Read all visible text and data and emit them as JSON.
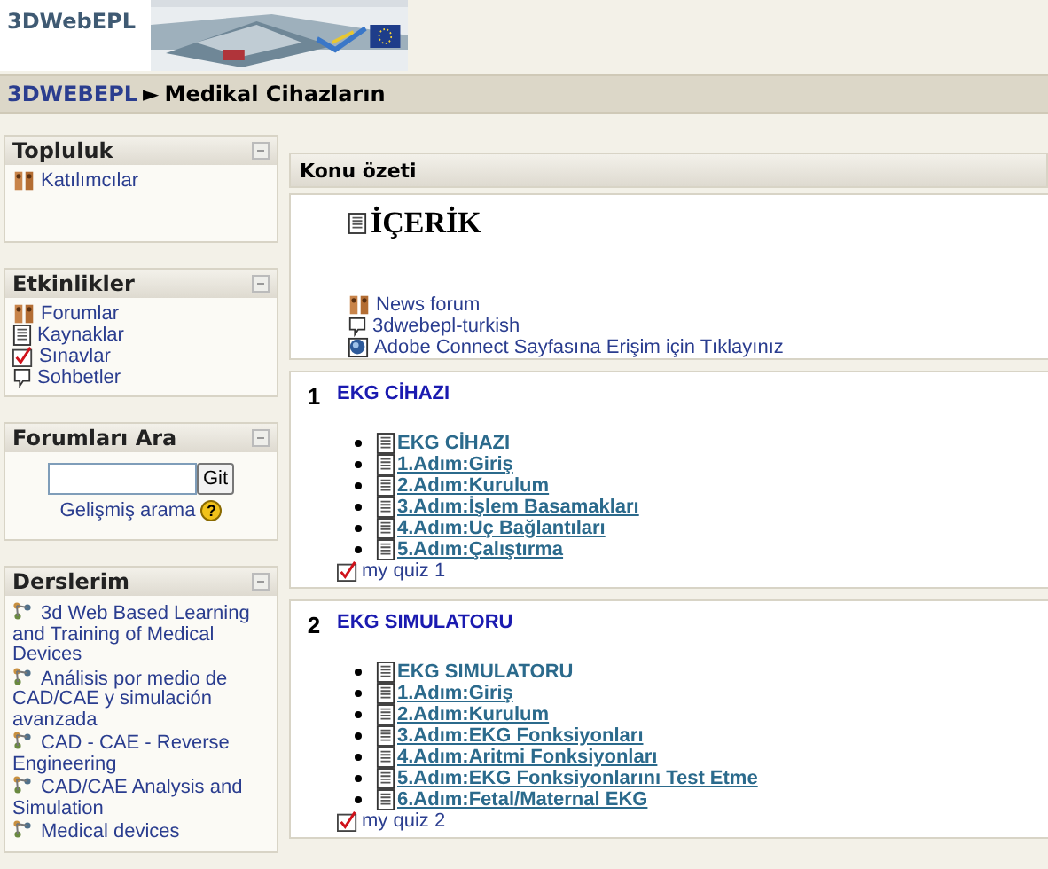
{
  "header": {
    "logo": "3DWebEPL"
  },
  "breadcrumb": {
    "home": "3DWEBEPL",
    "separator": "►",
    "current": "Medikal Cihazların"
  },
  "sidebar": [
    {
      "title": "Topluluk",
      "kind": "links",
      "items": [
        {
          "label": "Katılımcılar",
          "kind": "people"
        }
      ]
    },
    {
      "title": "Etkinlikler",
      "kind": "links",
      "items": [
        {
          "label": "Forumlar",
          "kind": "people"
        },
        {
          "label": "Kaynaklar",
          "kind": "page"
        },
        {
          "label": "Sınavlar",
          "kind": "quiz"
        },
        {
          "label": "Sohbetler",
          "kind": "chat"
        }
      ]
    },
    {
      "title": "Forumları Ara",
      "kind": "search",
      "button": "Git",
      "link": "Gelişmiş arama",
      "help": "?"
    },
    {
      "title": "Derslerim",
      "kind": "courses",
      "items": [
        {
          "label": "3d Web Based Learning and Training of Medical Devices",
          "kind": "course"
        },
        {
          "label": "Análisis por medio de CAD/CAE y simulación avanzada",
          "kind": "course"
        },
        {
          "label": "CAD - CAE - Reverse Engineering",
          "kind": "course"
        },
        {
          "label": "CAD/CAE Analysis and Simulation",
          "kind": "course"
        },
        {
          "label": "Medical devices",
          "kind": "course"
        }
      ]
    }
  ],
  "main": {
    "title": "Konu özeti",
    "sections": [
      {
        "kind": "intro",
        "heading": "İÇERİK",
        "items": [
          {
            "label": "News forum",
            "kind": "people"
          },
          {
            "label": "3dwebepl-turkish",
            "kind": "chat"
          },
          {
            "label": "Adobe Connect Sayfasına Erişim için Tıklayınız",
            "kind": "globe"
          }
        ]
      },
      {
        "kind": "topic",
        "number": "1",
        "title": "EKG CİHAZI",
        "resources": [
          {
            "label": "EKG CİHAZI",
            "underlined": false
          },
          {
            "label": "1.Adım:Giriş",
            "underlined": true
          },
          {
            "label": "2.Adım:Kurulum",
            "underlined": true
          },
          {
            "label": "3.Adım:İşlem Basamakları",
            "underlined": true
          },
          {
            "label": "4.Adım:Uç Bağlantıları",
            "underlined": true
          },
          {
            "label": "5.Adım:Çalıştırma",
            "underlined": true
          }
        ],
        "quiz": "my quiz 1"
      },
      {
        "kind": "topic",
        "number": "2",
        "title": "EKG SIMULATORU",
        "resources": [
          {
            "label": "EKG SIMULATORU",
            "underlined": false
          },
          {
            "label": "1.Adım:Giriş",
            "underlined": true
          },
          {
            "label": "2.Adım:Kurulum",
            "underlined": true
          },
          {
            "label": "3.Adım:EKG Fonksiyonları",
            "underlined": true
          },
          {
            "label": "4.Adım:Aritmi Fonksiyonları",
            "underlined": true
          },
          {
            "label": "5.Adım:EKG Fonksiyonlarını Test Etme",
            "underlined": true
          },
          {
            "label": "6.Adım:Fetal/Maternal EKG",
            "underlined": true
          }
        ],
        "quiz": "my quiz 2"
      }
    ]
  }
}
